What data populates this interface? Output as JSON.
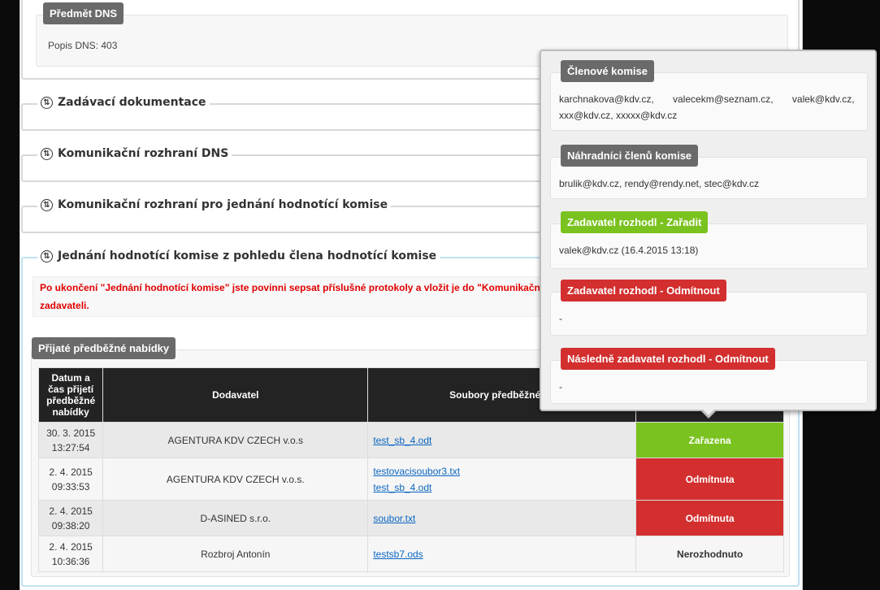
{
  "dns_section": {
    "badge": "Předmět DNS",
    "text": "Popis DNS: 403"
  },
  "collapsed_sections": [
    {
      "label": "Zadávací dokumentace"
    },
    {
      "label": "Komunikační rozhraní DNS"
    },
    {
      "label": "Komunikační rozhraní pro jednání hodnotící komise"
    }
  ],
  "main_section": {
    "label": "Jednání hodnotící komise z pohledu člena hodnotící komise",
    "warning_line1": "Po ukončení \"Jednání hodnotící komise\" jste povinni sepsat příslušné protokoly a vložit je do \"Komunikační r",
    "warning_line2": "zadavateli."
  },
  "offers": {
    "badge": "Přijaté předběžné nabídky",
    "columns": [
      "Datum a čas přijetí předběžné nabídky",
      "Dodavatel",
      "Soubory předběžné na",
      ""
    ],
    "rows": [
      {
        "date": "30. 3. 2015",
        "time": "13:27:54",
        "supplier": "AGENTURA KDV CZECH v.o.s",
        "files": [
          "test_sb_4.odt"
        ],
        "status": "Zařazena",
        "status_type": "ok"
      },
      {
        "date": "2. 4. 2015",
        "time": "09:33:53",
        "supplier": "AGENTURA KDV CZECH v.o.s.",
        "files": [
          "testovacisoubor3.txt",
          "test_sb_4.odt"
        ],
        "status": "Odmítnuta",
        "status_type": "no"
      },
      {
        "date": "2. 4. 2015",
        "time": "09:38:20",
        "supplier": "D-ASINED s.r.o.",
        "files": [
          "soubor.txt"
        ],
        "status": "Odmítnuta",
        "status_type": "no"
      },
      {
        "date": "2. 4. 2015",
        "time": "10:36:36",
        "supplier": "Rozbroj Antonín",
        "files": [
          "testsb7.ods"
        ],
        "status": "Nerozhodnuto",
        "status_type": "und"
      }
    ]
  },
  "popover": {
    "members": {
      "badge": "Členové komise",
      "line1": "karchnakova@kdv.cz,       valecekm@seznam.cz,       valek@kdv.cz,",
      "line2": "xxx@kdv.cz, xxxxx@kdv.cz"
    },
    "substitutes": {
      "badge": "Náhradníci členů komise",
      "text": "brulik@kdv.cz, rendy@rendy.net, stec@kdv.cz"
    },
    "decided_include": {
      "badge": "Zadavatel rozhodl - Zařadit",
      "text": "valek@kdv.cz (16.4.2015 13:18)"
    },
    "decided_reject": {
      "badge": "Zadavatel rozhodl - Odmítnout",
      "text": "-"
    },
    "later_reject": {
      "badge": "Následně zadavatel rozhodl - Odmítnout",
      "text": "-"
    }
  },
  "colors": {
    "green": "#7ac21f",
    "red": "#d32f2f",
    "dark_header": "#232323",
    "badge_gray": "#6a6a6a"
  }
}
